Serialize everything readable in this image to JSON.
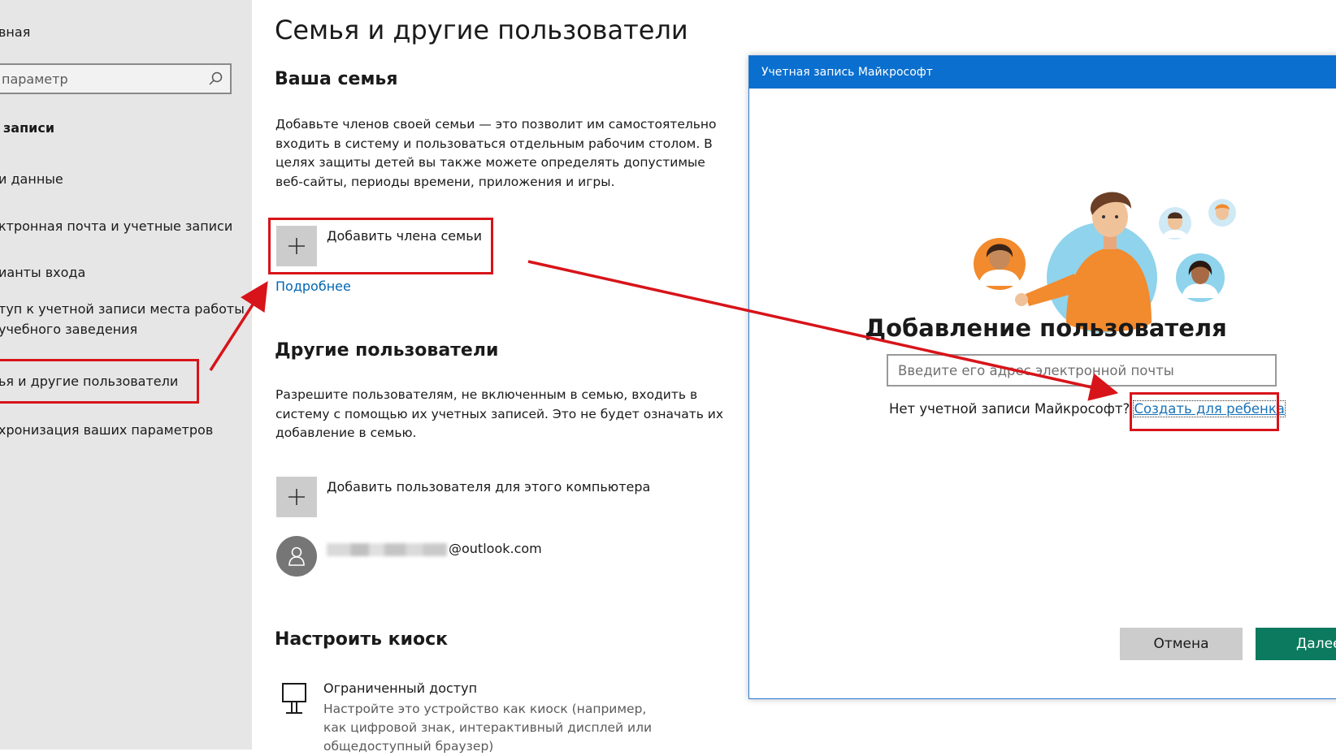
{
  "sidebar": {
    "home_label": "вная",
    "search_placeholder": "параметр",
    "section_title": "записи",
    "items": [
      {
        "label": "и данные"
      },
      {
        "label": "ктронная почта и учетные записи"
      },
      {
        "label": "ианты входа"
      },
      {
        "label": "туп к учетной записи места работы"
      },
      {
        "label": "учебного заведения"
      },
      {
        "label": "ья и другие пользователи"
      },
      {
        "label": "хронизация ваших параметров"
      }
    ]
  },
  "main": {
    "title": "Семья и другие пользователи",
    "family": {
      "heading": "Ваша семья",
      "description": "Добавьте членов своей семьи — это позволит им самостоятельно входить в систему и пользоваться отдельным рабочим столом. В целях защиты детей вы также можете определять допустимые веб-сайты, периоды времени, приложения и игры.",
      "add_label": "Добавить члена семьи",
      "more_link": "Подробнее"
    },
    "others": {
      "heading": "Другие пользователи",
      "description": "Разрешите пользователям, не включенным в семью, входить в систему с помощью их учетных записей. Это не будет означать их добавление в семью.",
      "add_label": "Добавить пользователя для этого компьютера",
      "user_email_suffix": "@outlook.com"
    },
    "kiosk": {
      "heading": "Настроить киоск",
      "title": "Ограниченный доступ",
      "description": "Настройте это устройство как киоск (например, как цифровой знак, интерактивный дисплей или общедоступный браузер)"
    }
  },
  "dialog": {
    "titlebar": "Учетная запись Майкрософт",
    "heading": "Добавление пользователя",
    "email_placeholder": "Введите его адрес электронной почты",
    "no_account_text": "Нет учетной записи Майкрософт?",
    "create_child_link": "Создать для ребенка",
    "cancel_label": "Отмена",
    "next_label": "Далее"
  },
  "colors": {
    "highlight": "#d7141a",
    "link": "#0066b4",
    "titlebar": "#0a6fcf",
    "primary_button": "#0b7a5e",
    "sidebar_bg": "#e6e6e6",
    "illustration_orange": "#f28a2e",
    "illustration_blue": "#8fd3ec"
  }
}
